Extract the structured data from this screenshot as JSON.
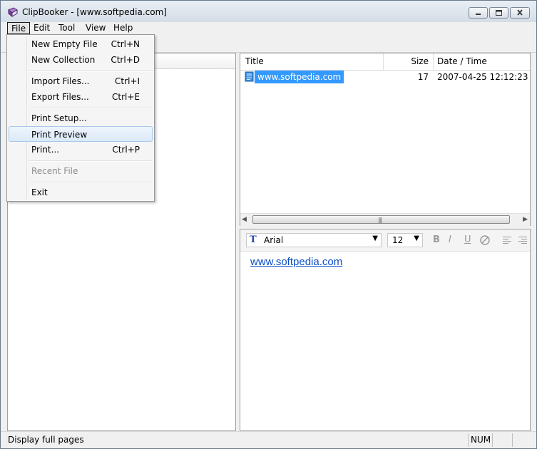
{
  "window": {
    "title": "ClipBooker - [www.softpedia.com]"
  },
  "menubar": {
    "items": [
      "File",
      "Edit",
      "Tool",
      "View",
      "Help"
    ]
  },
  "file_menu": {
    "items": [
      {
        "label": "New Empty File",
        "shortcut": "Ctrl+N"
      },
      {
        "label": "New Collection",
        "shortcut": "Ctrl+D"
      },
      {
        "label": "Import Files...",
        "shortcut": "Ctrl+I"
      },
      {
        "label": "Export Files...",
        "shortcut": "Ctrl+E"
      },
      {
        "label": "Print Setup...",
        "shortcut": ""
      },
      {
        "label": "Print Preview",
        "shortcut": ""
      },
      {
        "label": "Print...",
        "shortcut": "Ctrl+P"
      },
      {
        "label": "Recent File",
        "shortcut": ""
      },
      {
        "label": "Exit",
        "shortcut": ""
      }
    ]
  },
  "list": {
    "columns": [
      "Title",
      "Size",
      "Date / Time"
    ],
    "rows": [
      {
        "title": "www.softpedia.com",
        "size": "17",
        "date": "2007-04-25 12:12:23"
      }
    ]
  },
  "editor": {
    "font": "Arial",
    "size": "12",
    "content": "www.softpedia.com",
    "format_buttons": [
      "B",
      "I",
      "U"
    ]
  },
  "status": {
    "text": "Display full pages",
    "num": "NUM"
  },
  "colors": {
    "selection": "#3399ff",
    "link": "#0b4ec5"
  }
}
